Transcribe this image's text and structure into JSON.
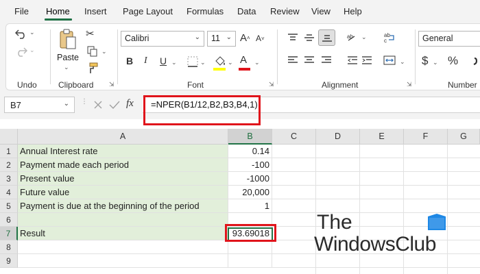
{
  "menu": {
    "items": [
      "File",
      "Home",
      "Insert",
      "Page Layout",
      "Formulas",
      "Data",
      "Review",
      "View",
      "Help"
    ],
    "active": "Home"
  },
  "ribbon": {
    "undo_label": "Undo",
    "clipboard_label": "Clipboard",
    "paste_label": "Paste",
    "font_group_label": "Font",
    "font_name": "Calibri",
    "font_size": "11",
    "alignment_label": "Alignment",
    "number_label": "Number",
    "number_format": "General",
    "currency_symbol": "$",
    "percent_symbol": "%",
    "font_color": "#e0141b"
  },
  "formula_bar": {
    "name_box": "B7",
    "formula": "=NPER(B1/12,B2,B3,B4,1)"
  },
  "sheet": {
    "columns": [
      "A",
      "B",
      "C",
      "D",
      "E",
      "F",
      "G"
    ],
    "selected_column": "B",
    "selected_row": "7",
    "rows": [
      {
        "num": "1",
        "a": "Annual Interest rate",
        "b": "0.14"
      },
      {
        "num": "2",
        "a": "Payment made each period",
        "b": "-100"
      },
      {
        "num": "3",
        "a": "Present value",
        "b": "-1000"
      },
      {
        "num": "4",
        "a": "Future value",
        "b": "20,000"
      },
      {
        "num": "5",
        "a": "Payment is due at the beginning of the period",
        "b": "1"
      },
      {
        "num": "6",
        "a": "",
        "b": ""
      },
      {
        "num": "7",
        "a": "Result",
        "b": "93.69018"
      },
      {
        "num": "8",
        "a": "",
        "b": ""
      },
      {
        "num": "9",
        "a": "",
        "b": ""
      }
    ]
  },
  "watermark": {
    "line1": "The",
    "line2": "WindowsClub"
  },
  "colors": {
    "accent_green": "#217346",
    "label_fill": "#e2efda",
    "highlight_red": "#e0141b"
  }
}
